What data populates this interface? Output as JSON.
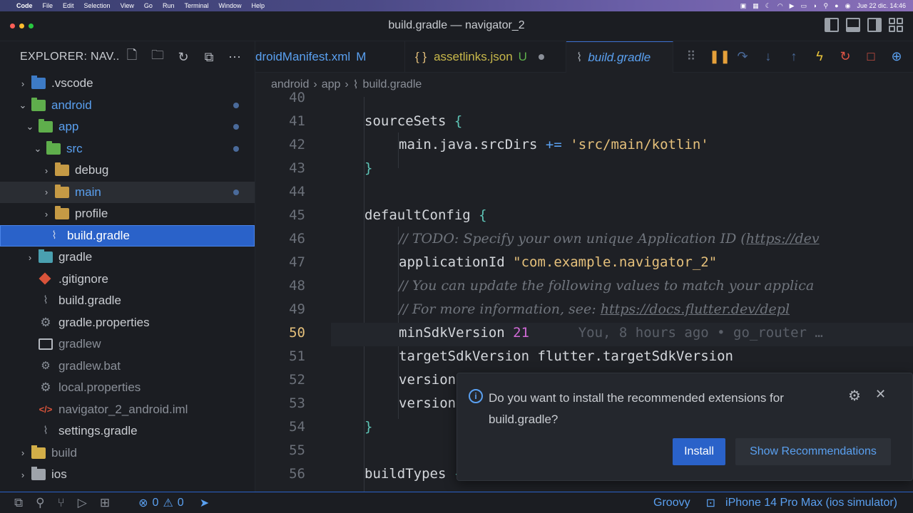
{
  "menubar": {
    "app_name": "Code",
    "items": [
      "File",
      "Edit",
      "Selection",
      "View",
      "Go",
      "Run",
      "Terminal",
      "Window",
      "Help"
    ],
    "clock": "Jue 22 dic.  14:46"
  },
  "window": {
    "title": "build.gradle — navigator_2"
  },
  "explorer": {
    "title": "EXPLORER: NAV...",
    "tree": [
      {
        "label": ".vscode",
        "chev": "›"
      },
      {
        "label": "android",
        "chev": "⌄"
      },
      {
        "label": "app",
        "chev": "⌄"
      },
      {
        "label": "src",
        "chev": "⌄"
      },
      {
        "label": "debug",
        "chev": "›"
      },
      {
        "label": "main",
        "chev": "›"
      },
      {
        "label": "profile",
        "chev": "›"
      },
      {
        "label": "build.gradle"
      },
      {
        "label": "gradle",
        "chev": "›"
      },
      {
        "label": ".gitignore"
      },
      {
        "label": "build.gradle"
      },
      {
        "label": "gradle.properties"
      },
      {
        "label": "gradlew"
      },
      {
        "label": "gradlew.bat"
      },
      {
        "label": "local.properties"
      },
      {
        "label": "navigator_2_android.iml"
      },
      {
        "label": "settings.gradle"
      },
      {
        "label": "build",
        "chev": "›"
      },
      {
        "label": "ios",
        "chev": "›"
      }
    ]
  },
  "tabs": [
    {
      "label": "droidManifest.xml",
      "badge": "M"
    },
    {
      "label": "assetlinks.json",
      "badge": "U",
      "prefix": "{ }"
    },
    {
      "label": "build.gradle"
    }
  ],
  "breadcrumb": [
    "android",
    "app",
    "build.gradle"
  ],
  "code": {
    "line_numbers": [
      "40",
      "41",
      "42",
      "43",
      "44",
      "45",
      "46",
      "47",
      "48",
      "49",
      "50",
      "51",
      "52",
      "53",
      "54",
      "55",
      "56"
    ],
    "l41": "sourceSets",
    "l42_a": "main.java.srcDirs ",
    "l42_op": "+=",
    "l42_str": "'src/main/kotlin'",
    "l45": "defaultConfig",
    "l46_comment": "// TODO: Specify your own unique Application ID (",
    "l46_link": "https://dev",
    "l47_a": "applicationId ",
    "l47_str": "\"com.example.navigator_2\"",
    "l48_comment": "// You can update the following values to match your applica",
    "l49_comment": "// For more information, see: ",
    "l49_link": "https://docs.flutter.dev/depl",
    "l50_a": "minSdkVersion ",
    "l50_num": "21",
    "l50_blame": "You, 8 hours ago • go_router …",
    "l51": "targetSdkVersion flutter.targetSdkVersion",
    "l52": "version",
    "l53": "version",
    "l56": "buildTypes"
  },
  "notification": {
    "message": "Do you want to install the recommended extensions for build.gradle?",
    "install_label": "Install",
    "show_label": "Show Recommendations"
  },
  "statusbar": {
    "errors": "0",
    "warnings": "0",
    "language": "Groovy",
    "device": "iPhone 14 Pro Max (ios simulator)"
  }
}
